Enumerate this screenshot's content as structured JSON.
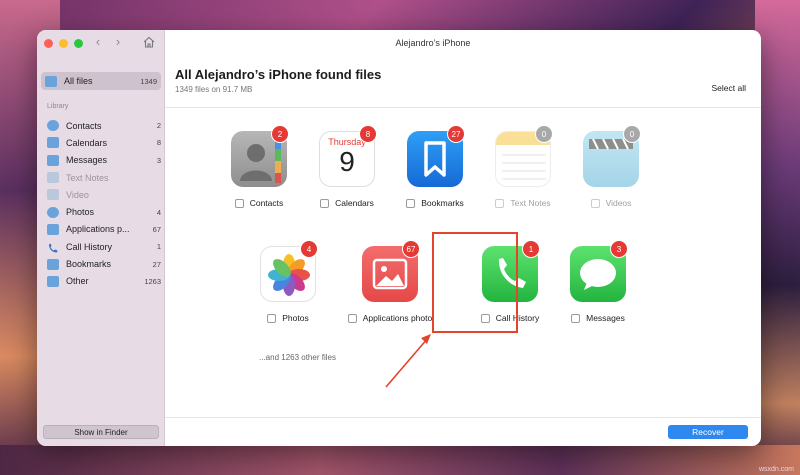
{
  "window": {
    "title": "Alejandro’s iPhone"
  },
  "sidebar": {
    "all_files": {
      "label": "All files",
      "count": "1349"
    },
    "section_label": "Library",
    "items": [
      {
        "label": "Contacts",
        "count": "2",
        "icon": "contacts-icon",
        "dim": false
      },
      {
        "label": "Calendars",
        "count": "8",
        "icon": "calendar-icon",
        "dim": false
      },
      {
        "label": "Messages",
        "count": "3",
        "icon": "messages-icon",
        "dim": false
      },
      {
        "label": "Text Notes",
        "count": "",
        "icon": "notes-icon",
        "dim": true
      },
      {
        "label": "Video",
        "count": "",
        "icon": "video-icon",
        "dim": true
      },
      {
        "label": "Photos",
        "count": "4",
        "icon": "photos-icon",
        "dim": false
      },
      {
        "label": "Applications p...",
        "count": "67",
        "icon": "applications-icon",
        "dim": false
      },
      {
        "label": "Call History",
        "count": "1",
        "icon": "phone-icon",
        "dim": false
      },
      {
        "label": "Bookmarks",
        "count": "27",
        "icon": "bookmark-icon",
        "dim": false
      },
      {
        "label": "Other",
        "count": "1263",
        "icon": "folder-icon",
        "dim": false
      }
    ],
    "show_in_finder": "Show in Finder"
  },
  "main": {
    "title": "All Alejandro’s iPhone found files",
    "subtitle": "1349 files on 91.7 MB",
    "select_all": "Select all",
    "calendar_day_name": "Thursday",
    "calendar_day_number": "9",
    "tiles": [
      {
        "label": "Contacts",
        "badge": "2"
      },
      {
        "label": "Calendars",
        "badge": "8"
      },
      {
        "label": "Bookmarks",
        "badge": "27"
      },
      {
        "label": "Text Notes",
        "badge": "0"
      },
      {
        "label": "Videos",
        "badge": "0"
      },
      {
        "label": "Photos",
        "badge": "4"
      },
      {
        "label": "Applications photo",
        "badge": "67"
      },
      {
        "label": "Call History",
        "badge": "1"
      },
      {
        "label": "Messages",
        "badge": "3"
      }
    ],
    "other_files": "...and 1263 other files",
    "recover": "Recover"
  },
  "watermark": "wsxdn.com",
  "colors": {
    "accent": "#2e88f0",
    "badge": "#e53935",
    "highlight": "#e4452a"
  }
}
